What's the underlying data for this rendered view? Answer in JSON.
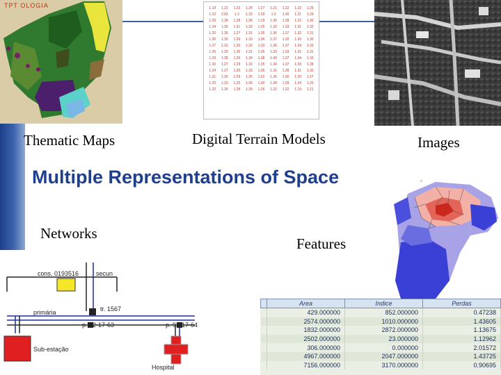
{
  "slide": {
    "title": "Multiple Representations of Space",
    "captions": {
      "thematic_maps": "Thematic Maps",
      "digital_terrain_models": "Digital Terrain Models",
      "images": "Images",
      "networks": "Networks",
      "features": "Features"
    }
  },
  "thematic_map": {
    "label": "TPT OLOGIA"
  },
  "dtm_values": [
    [
      "1.19",
      "1.21",
      "1.23",
      "1.24",
      "1.27",
      "1.21",
      "1.22",
      "1.22",
      "1.25"
    ],
    [
      "1.22",
      "2.03",
      "1.3",
      "1.33",
      "1.29",
      "1.3",
      "1.30",
      "1.21",
      "1.29"
    ],
    [
      "1.26",
      "1.28",
      "1.28",
      "1.28",
      "1.29",
      "1.30",
      "1.28",
      "1.22",
      "1.30"
    ],
    [
      "1.24",
      "1.26",
      "1.31",
      "1.33",
      "1.35",
      "1.32",
      "1.33",
      "1.31",
      "1.32"
    ],
    [
      "1.20",
      "1.26",
      "1.27",
      "1.31",
      "1.35",
      "1.36",
      "1.37",
      "1.32",
      "1.31"
    ],
    [
      "1.30",
      "1.30",
      "1.26",
      "1.33",
      "1.36",
      "1.37",
      "1.32",
      "1.33",
      "1.30"
    ],
    [
      "1.27",
      "1.31",
      "1.30",
      "1.32",
      "1.33",
      "1.36",
      "1.37",
      "1.34",
      "1.33"
    ],
    [
      "1.26",
      "1.29",
      "1.30",
      "1.31",
      "1.35",
      "1.33",
      "1.33",
      "1.32",
      "1.31"
    ],
    [
      "1.29",
      "1.28",
      "1.26",
      "1.34",
      "1.38",
      "1.40",
      "1.37",
      "1.34",
      "1.33"
    ],
    [
      "1.30",
      "1.27",
      "1.29",
      "1.32",
      "1.35",
      "1.34",
      "1.37",
      "1.33",
      "1.28"
    ],
    [
      "1.24",
      "1.27",
      "1.30",
      "1.33",
      "1.36",
      "1.31",
      "1.28",
      "1.31",
      "1.30"
    ],
    [
      "1.21",
      "1.26",
      "1.29",
      "1.25",
      "1.22",
      "1.26",
      "1.30",
      "1.29",
      "1.27"
    ],
    [
      "1.20",
      "1.23",
      "1.25",
      "1.26",
      "1.30",
      "1.28",
      "1.29",
      "1.24",
      "1.20"
    ],
    [
      "1.22",
      "1.25",
      "1.28",
      "1.30",
      "1.26",
      "1.22",
      "1.22",
      "1.19",
      "1.21"
    ]
  ],
  "network": {
    "labels": {
      "consumer": "cons. 0193516",
      "secondary": "secun",
      "primary": "primária",
      "transformer": "tr. 1567",
      "pole_1": "p. 92-17-63",
      "pole_2": "p. 92-17-64",
      "substation": "Sub-estação",
      "hospital": "Hospital"
    }
  },
  "features_table": {
    "columns": [
      "Area",
      "Indice",
      "Perdas"
    ],
    "rows": [
      [
        "429.000000",
        "852.000000",
        "0.47238"
      ],
      [
        "2574.000000",
        "1010.000000",
        "1.43605"
      ],
      [
        "1832.000000",
        "2872.000000",
        "1.13675"
      ],
      [
        "2502.000000",
        "23.000000",
        "1.12962"
      ],
      [
        "306.000000",
        "0.000000",
        "2.01572"
      ],
      [
        "4967.000000",
        "2047.000000",
        "1.43725"
      ],
      [
        "7156.000000",
        "3170.000000",
        "0.90695"
      ]
    ]
  },
  "colors": {
    "title": "#1e3f8c",
    "sidebar": "#2a4f9c",
    "substation": "#e02020",
    "hospital": "#e02020",
    "consumer": "#f5e62a",
    "choropleth_high": "#d93a2a",
    "choropleth_low": "#3a3fd6"
  },
  "icons": [
    "red-cross-hospital-icon"
  ]
}
